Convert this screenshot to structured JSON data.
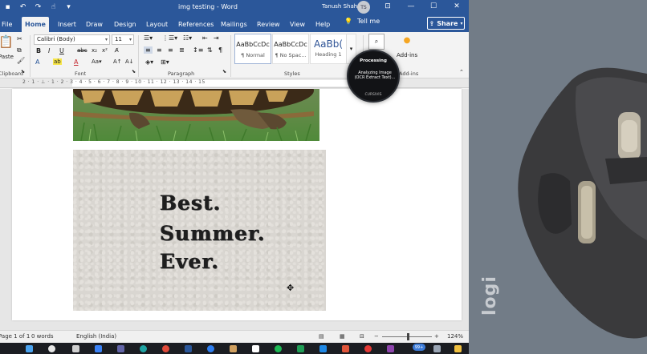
{
  "titlebar": {
    "doc_title": "img testing - Word",
    "user_name": "Tanush Shah",
    "avatar_initials": "TS"
  },
  "tabs": [
    "File",
    "Home",
    "Insert",
    "Draw",
    "Design",
    "Layout",
    "References",
    "Mailings",
    "Review",
    "View",
    "Help"
  ],
  "active_tab": "Home",
  "tell_me": "Tell me",
  "share_label": "Share",
  "ribbon": {
    "clipboard": {
      "paste": "Paste",
      "label": "Clipboard"
    },
    "font": {
      "name": "Calibri (Body)",
      "size": "11",
      "label": "Font"
    },
    "paragraph": {
      "label": "Paragraph"
    },
    "styles": {
      "items": [
        {
          "preview": "AaBbCcDc",
          "name": "¶ Normal"
        },
        {
          "preview": "AaBbCcDc",
          "name": "¶ No Spac..."
        },
        {
          "preview": "AaBb(",
          "name": "Heading 1"
        }
      ],
      "label": "Styles"
    },
    "addins": {
      "button": "Add-ins",
      "label": "Add-ins"
    }
  },
  "ruler_numbers": "2 · 1 · ⊥ · 1 · 2 · 3 · 4 · 5 · 6 · 7 · 8 · 9 · 10 · 11 · 12 · 13 · 14 · 15",
  "document": {
    "image_text": [
      "Best.",
      "Summer.",
      "Ever."
    ]
  },
  "processing": {
    "title": "Processing",
    "message": "Analyzing Image (OCR Extract Text)...",
    "brand": "CURSIVIS"
  },
  "status": {
    "page": "Page 1 of 1",
    "words": "0 words",
    "language": "English (India)",
    "zoom": "124%"
  },
  "taskbar": {
    "badge": "99+"
  },
  "desk": {
    "brand_logo": "logi"
  },
  "colors": {
    "word_blue": "#2b579a",
    "taskbar": "#1b1d22",
    "desk_mat": "#727b86"
  }
}
